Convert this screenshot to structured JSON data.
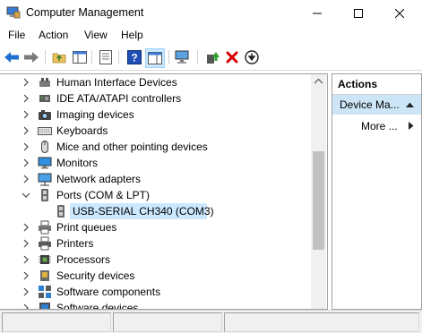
{
  "window": {
    "title": "Computer Management"
  },
  "menu": [
    "File",
    "Action",
    "View",
    "Help"
  ],
  "tree": {
    "items": [
      {
        "label": "Human Interface Devices",
        "icon": "hid-icon"
      },
      {
        "label": "IDE ATA/ATAPI controllers",
        "icon": "ide-controller-icon"
      },
      {
        "label": "Imaging devices",
        "icon": "camera-icon"
      },
      {
        "label": "Keyboards",
        "icon": "keyboard-icon"
      },
      {
        "label": "Mice and other pointing devices",
        "icon": "mouse-icon"
      },
      {
        "label": "Monitors",
        "icon": "monitor-icon"
      },
      {
        "label": "Network adapters",
        "icon": "network-adapter-icon"
      },
      {
        "label": "Ports (COM & LPT)",
        "icon": "port-icon",
        "expanded": true
      },
      {
        "label": "Print queues",
        "icon": "print-queue-icon"
      },
      {
        "label": "Printers",
        "icon": "printer-icon"
      },
      {
        "label": "Processors",
        "icon": "processor-icon"
      },
      {
        "label": "Security devices",
        "icon": "security-device-icon"
      },
      {
        "label": "Software components",
        "icon": "software-component-icon"
      },
      {
        "label": "Software devices",
        "icon": "software-device-icon"
      }
    ],
    "selected_child": {
      "label": "USB-SERIAL CH340 (COM3)",
      "icon": "serial-port-icon"
    }
  },
  "actions": {
    "header": "Actions",
    "section": "Device Ma...",
    "more": "More ..."
  },
  "colors": {
    "selection": "#cce8ff",
    "actions_section": "#cde6f7",
    "delete_red": "#d40000",
    "back_blue": "#1e6fd0"
  }
}
